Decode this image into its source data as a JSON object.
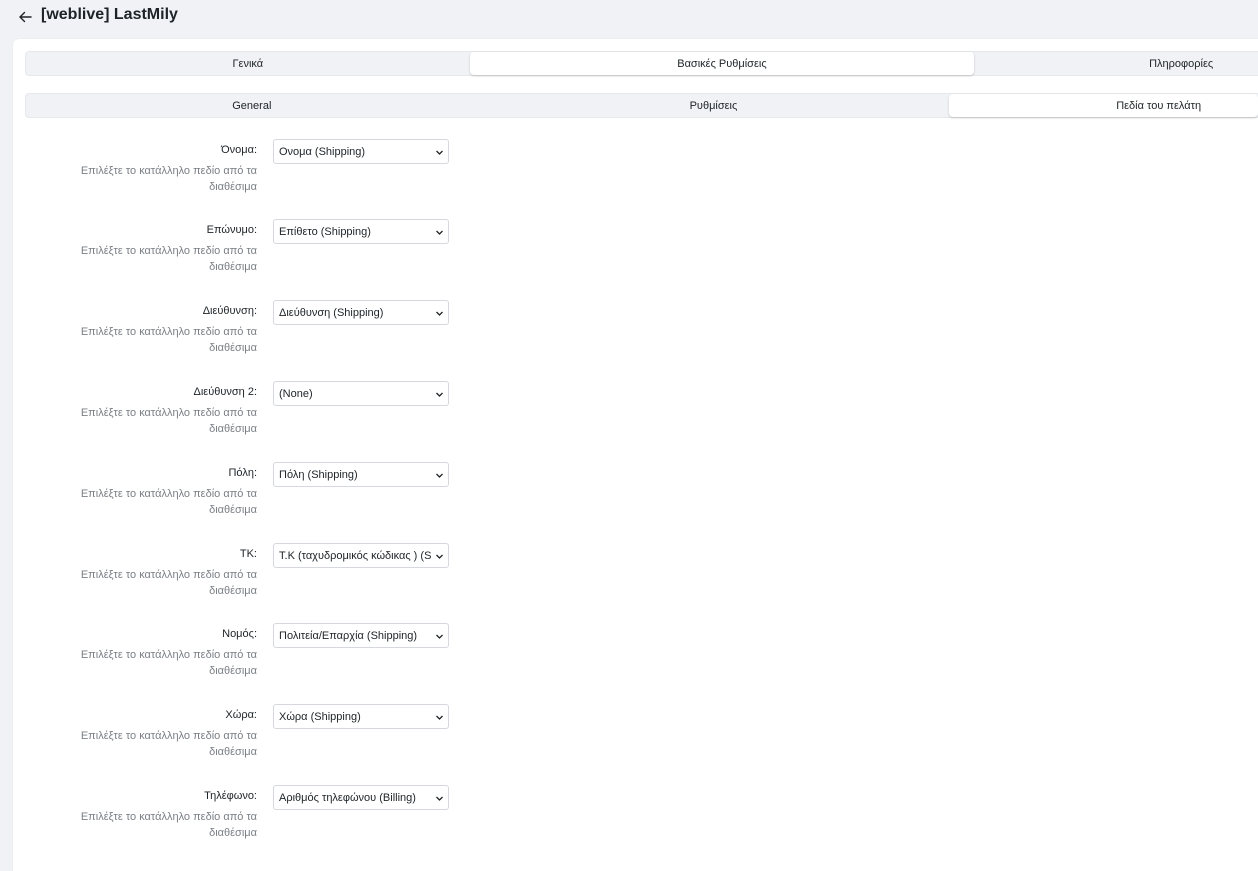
{
  "header": {
    "title": "[weblive] LastMily"
  },
  "tabs": [
    {
      "label": "Γενικά"
    },
    {
      "label": "Βασικές Ρυθμίσεις"
    },
    {
      "label": "Πληροφορίες"
    }
  ],
  "subtabs": [
    {
      "label": "General"
    },
    {
      "label": "Ρυθμίσεις"
    },
    {
      "label": "Πεδία του πελάτη"
    }
  ],
  "fields": [
    {
      "label": "Όνομα:",
      "help": "Επιλέξτε το κατάλληλο πεδίο από τα διαθέσιμα",
      "value": "Ονομα (Shipping)"
    },
    {
      "label": "Επώνυμο:",
      "help": "Επιλέξτε το κατάλληλο πεδίο από τα διαθέσιμα",
      "value": "Επίθετο (Shipping)"
    },
    {
      "label": "Διεύθυνση:",
      "help": "Επιλέξτε το κατάλληλο πεδίο από τα διαθέσιμα",
      "value": "Διεύθυνση (Shipping)"
    },
    {
      "label": "Διεύθυνση 2:",
      "help": "Επιλέξτε το κατάλληλο πεδίο από τα διαθέσιμα",
      "value": "(None)"
    },
    {
      "label": "Πόλη:",
      "help": "Επιλέξτε το κατάλληλο πεδίο από τα διαθέσιμα",
      "value": "Πόλη (Shipping)"
    },
    {
      "label": "ΤΚ:",
      "help": "Επιλέξτε το κατάλληλο πεδίο από τα διαθέσιμα",
      "value": "Τ.Κ (ταχυδρομικός κώδικας ) (Shipping)"
    },
    {
      "label": "Νομός:",
      "help": "Επιλέξτε το κατάλληλο πεδίο από τα διαθέσιμα",
      "value": "Πολιτεία/Επαρχία (Shipping)"
    },
    {
      "label": "Χώρα:",
      "help": "Επιλέξτε το κατάλληλο πεδίο από τα διαθέσιμα",
      "value": "Χώρα (Shipping)"
    },
    {
      "label": "Τηλέφωνο:",
      "help": "Επιλέξτε το κατάλληλο πεδίο από τα διαθέσιμα",
      "value": "Αριθμός τηλεφώνου (Billing)"
    }
  ]
}
